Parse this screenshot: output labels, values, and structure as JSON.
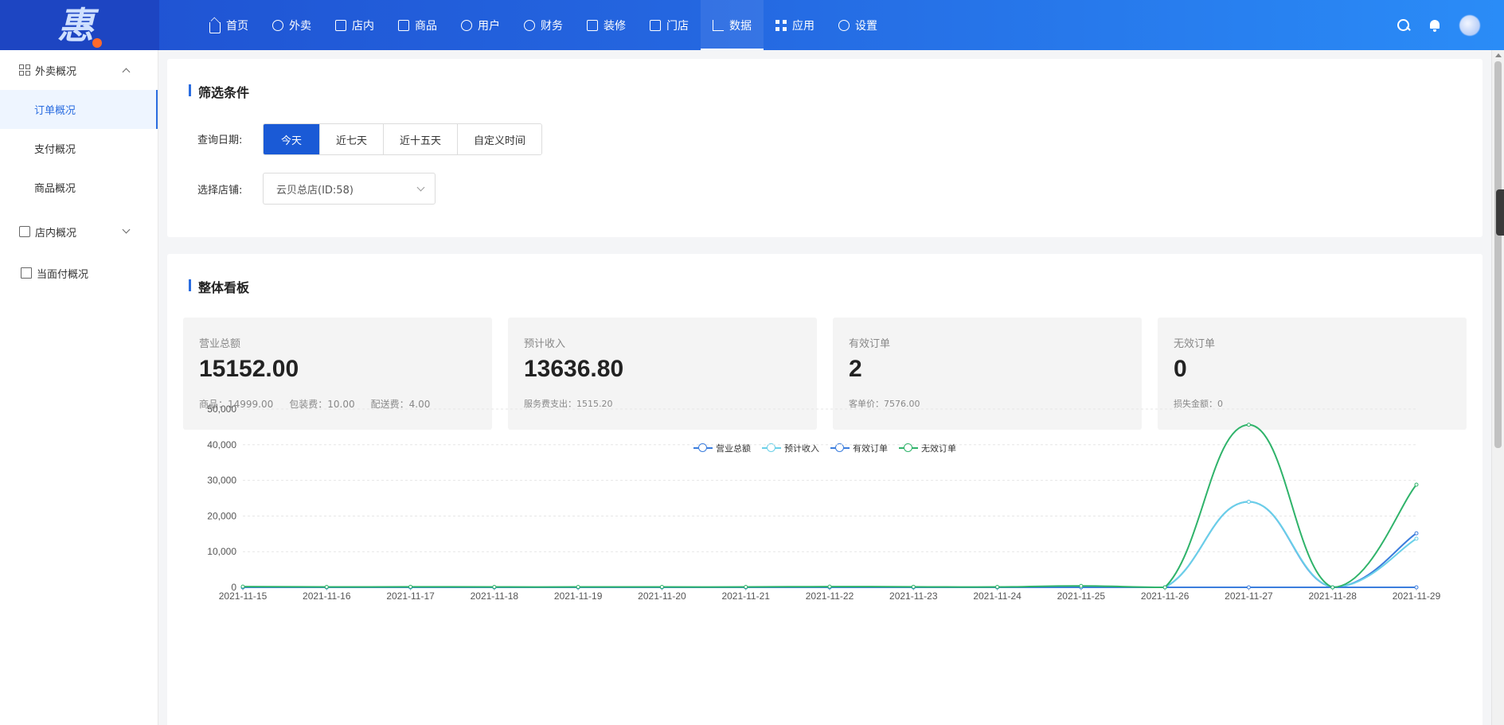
{
  "logo": {
    "glyph": "惠"
  },
  "nav": [
    {
      "label": "首页",
      "icon": "home-icon"
    },
    {
      "label": "外卖",
      "icon": "scooter-icon"
    },
    {
      "label": "店内",
      "icon": "store-inside-icon"
    },
    {
      "label": "商品",
      "icon": "bag-icon"
    },
    {
      "label": "用户",
      "icon": "user-icon"
    },
    {
      "label": "财务",
      "icon": "money-bag-icon"
    },
    {
      "label": "装修",
      "icon": "shop-front-icon"
    },
    {
      "label": "门店",
      "icon": "storefront-icon"
    },
    {
      "label": "数据",
      "icon": "line-chart-icon",
      "active": true
    },
    {
      "label": "应用",
      "icon": "apps-grid-icon"
    },
    {
      "label": "设置",
      "icon": "gear-icon"
    }
  ],
  "sidebar": {
    "groups": [
      {
        "label": "外卖概况",
        "icon": "grid-icon",
        "expanded": true,
        "items": [
          {
            "label": "订单概况",
            "active": true
          },
          {
            "label": "支付概况"
          },
          {
            "label": "商品概况"
          }
        ]
      },
      {
        "label": "店内概况",
        "icon": "chart-icon",
        "expanded": false,
        "items": []
      },
      {
        "label": "当面付概况",
        "icon": "document-icon",
        "items": []
      }
    ]
  },
  "filter": {
    "title": "筛选条件",
    "date_label": "查询日期:",
    "date_options": [
      "今天",
      "近七天",
      "近十五天",
      "自定义时间"
    ],
    "date_selected": "今天",
    "store_label": "选择店铺:",
    "store_value": "云贝总店(ID:58)"
  },
  "board": {
    "title": "整体看板",
    "stats": [
      {
        "label": "营业总额",
        "value": "15152.00",
        "subs": [
          "商品：14999.00",
          "包装费：10.00",
          "配送费：4.00"
        ]
      },
      {
        "label": "预计收入",
        "value": "13636.80",
        "subs": [
          "服务费支出：1515.20"
        ]
      },
      {
        "label": "有效订单",
        "value": "2",
        "subs": [
          "客单价：7576.00"
        ]
      },
      {
        "label": "无效订单",
        "value": "0",
        "subs": [
          "损失金额：0"
        ]
      }
    ]
  },
  "colors": {
    "accent": "#1a5ad6",
    "series_blue": "#3b7ddd",
    "series_cyan": "#6ad0e8",
    "series_green": "#2fb36a"
  },
  "chart_data": {
    "type": "line",
    "smooth": true,
    "legend_position": "top-center",
    "grid": "horizontal-dashed",
    "x": [
      "2021-11-15",
      "2021-11-16",
      "2021-11-17",
      "2021-11-18",
      "2021-11-19",
      "2021-11-20",
      "2021-11-21",
      "2021-11-22",
      "2021-11-23",
      "2021-11-24",
      "2021-11-25",
      "2021-11-26",
      "2021-11-27",
      "2021-11-28",
      "2021-11-29"
    ],
    "yticks": [
      "0",
      "10,000",
      "20,000",
      "30,000",
      "40,000",
      "50,000"
    ],
    "ylim": [
      0,
      50000
    ],
    "series": [
      {
        "name": "营业总额",
        "color": "#3b7ddd",
        "values": [
          0,
          0,
          0,
          0,
          0,
          0,
          0,
          0,
          0,
          0,
          0,
          0,
          24000,
          0,
          15152
        ]
      },
      {
        "name": "预计收入",
        "color": "#6ad0e8",
        "values": [
          0,
          0,
          0,
          0,
          0,
          0,
          0,
          0,
          0,
          0,
          0,
          0,
          24000,
          0,
          13636.8
        ]
      },
      {
        "name": "有效订单",
        "color": "#3b7ddd",
        "values": [
          0,
          0,
          0,
          0,
          0,
          0,
          0,
          0,
          0,
          0,
          0,
          0,
          2,
          0,
          2
        ]
      },
      {
        "name": "无效订单",
        "color": "#2fb36a",
        "values": [
          200,
          100,
          150,
          100,
          100,
          100,
          100,
          200,
          150,
          100,
          400,
          0,
          45600,
          0,
          28800
        ]
      }
    ]
  }
}
